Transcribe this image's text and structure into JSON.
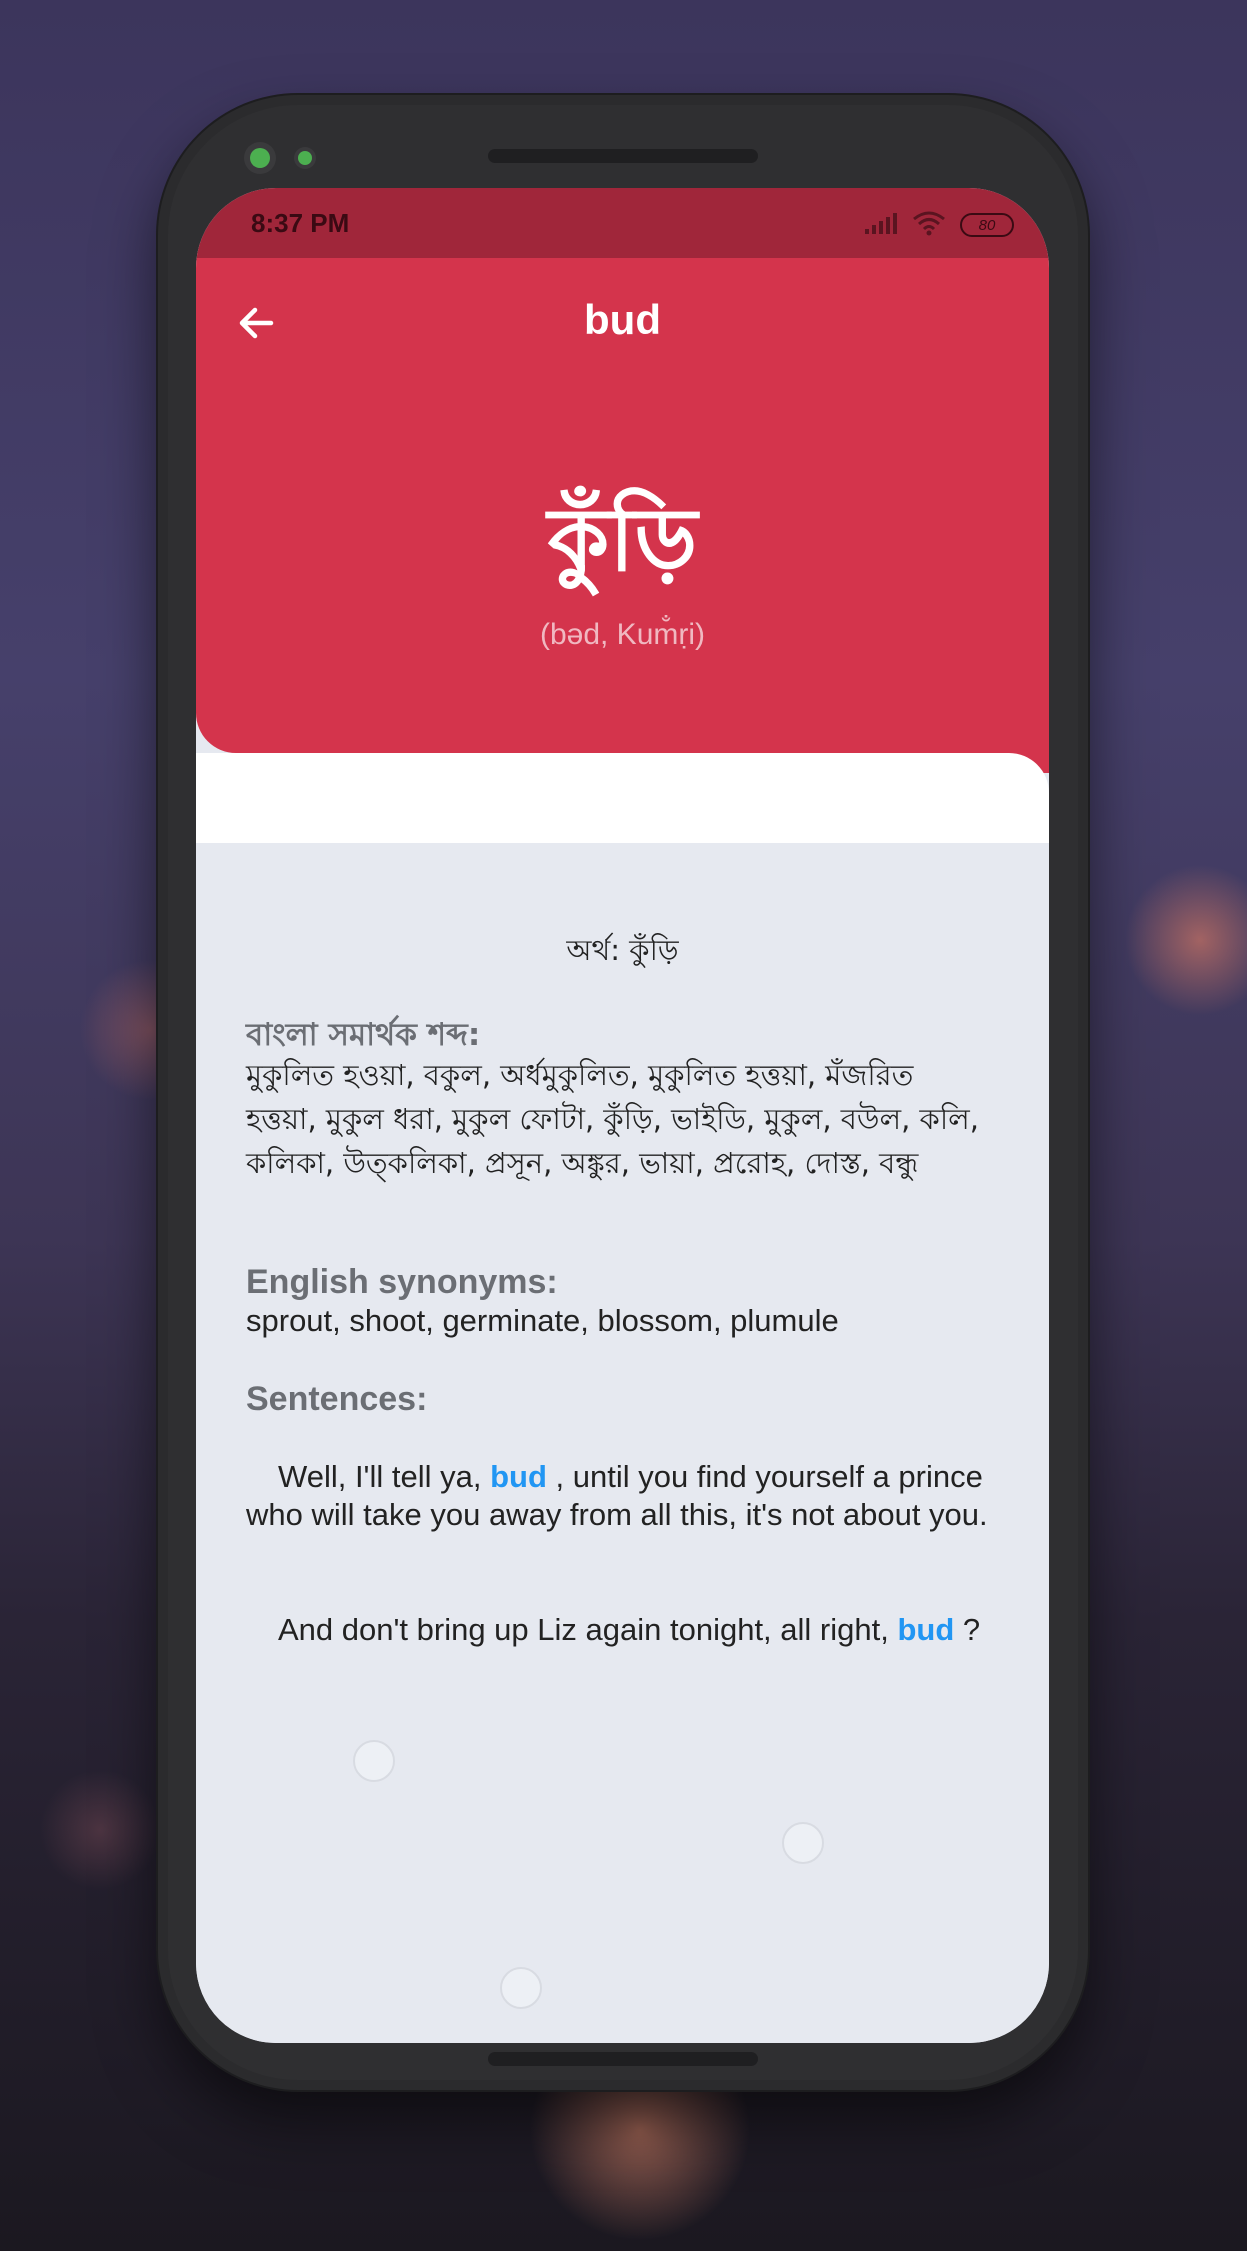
{
  "status_bar": {
    "time": "8:37 PM",
    "battery": "80"
  },
  "header": {
    "title": "bud",
    "bangla_word": "কুঁড়ি",
    "pronunciation": "(bəd, Kum̐ṛi)"
  },
  "content": {
    "meaning": "অর্থ: কুঁড়ি",
    "bangla_synonyms_label": "বাংলা সমার্থক শব্দ:",
    "bangla_synonyms": "মুকুলিত হওয়া, বকুল, অর্ধমুকুলিত, মুকুলিত হত্তয়া, মঁজরিত হত্তয়া, মুকুল ধরা, মুকুল ফোটা, কুঁড়ি, ভাইডি, মুকুল, বউল, কলি, কলিকা, উত্‌কলিকা, প্রসূন, অঙ্কুর, ভায়া, প্ররোহ, দোস্ত, বন্ধু",
    "english_synonyms_label": "English synonyms:",
    "english_synonyms": "sprout, shoot, germinate, blossom, plumule",
    "sentences_label": "Sentences:",
    "sentences": [
      {
        "before": "Well, I'll tell ya, ",
        "highlight": "bud",
        "after": " , until you find yourself a prince who will take you away from all this, it's not about you."
      },
      {
        "before": "And don't bring up Liz again tonight, all right, ",
        "highlight": "bud",
        "after": " ?"
      }
    ]
  },
  "colors": {
    "primary": "#d4344c",
    "status_bar": "#a0263a",
    "highlight": "#2196f3",
    "content_bg": "#e6e9f0"
  }
}
